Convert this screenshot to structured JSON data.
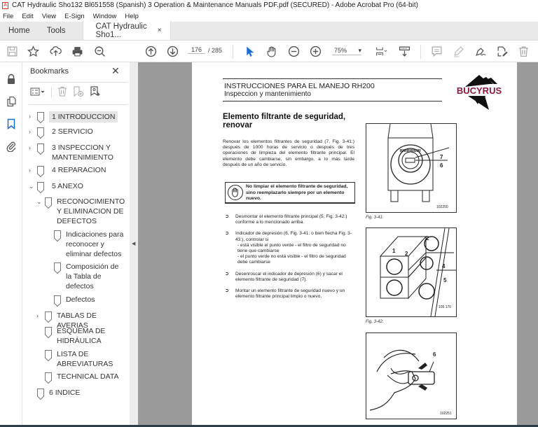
{
  "window": {
    "title": "CAT Hydraulic Sho132 Bl651558 (Spanish) 3 Operation & Maintenance Manuals PDF.pdf (SECURED) - Adobe Acrobat Pro (64-bit)"
  },
  "menu": [
    "File",
    "Edit",
    "View",
    "E-Sign",
    "Window",
    "Help"
  ],
  "tabs": {
    "home": "Home",
    "tools": "Tools",
    "document": "CAT Hydraulic Sho1...",
    "close": "×"
  },
  "toolbar": {
    "current_page": "176",
    "total_pages": "/ 285",
    "zoom": "75%",
    "zoom_arrow": "▾"
  },
  "panel": {
    "title": "Bookmarks",
    "close": "✕",
    "bookmarks": [
      {
        "label": "1 INTRODUCCION",
        "chevron": "›",
        "selected": true
      },
      {
        "label": "2 SERVICIO",
        "chevron": "›"
      },
      {
        "label": "3 INSPECCION Y MANTENIMIENTO",
        "chevron": "›"
      },
      {
        "label": "4 REPARACION",
        "chevron": "›"
      },
      {
        "label": "5 ANEXO",
        "chevron": "⌄"
      },
      {
        "label": "RECONOCIMIENTO Y ELIMINACION DE DEFECTOS",
        "chevron": "⌄"
      },
      {
        "label": "Indicaciones para reconocer y eliminar defectos"
      },
      {
        "label": "Composición de la Tabla de defectos"
      },
      {
        "label": "Defectos"
      },
      {
        "label": "TABLAS DE AVERIAS",
        "chevron": "›"
      },
      {
        "label": "ESQUEMA DE HIDRÁULICA"
      },
      {
        "label": "LISTA DE ABREVIATURAS"
      },
      {
        "label": "TECHNICAL DATA"
      },
      {
        "label": "6 INDICE"
      }
    ]
  },
  "document": {
    "header_line1": "INSTRUCCIONES PARA EL MANEJO RH200",
    "header_line2": "Inspeccion y mantenimiento",
    "logo": "BUCYRUS",
    "logo_color": "#8b1a3a",
    "section_title_1": "Elemento filtrante de seguridad,",
    "section_title_2": "renovar",
    "intro": "Renovar los elementos filtrantes de seguridad (7, Fig. 3-41:) después de 1000 horas de servicio o después de tres operaciones de limpieza del elemento filtrante principal. El elemento debe cambiarse, sin embargo, a lo más tarde después de un año de servicio.",
    "warning": "No limpiar el elemento filtrante de seguridad, sino reemplazarlo siempre por un elemento nuevo.",
    "bullet": "➲",
    "steps": [
      "Desmontar el elemento filtrante principal (5, Fig. 3-42:) conforme a lo mencionado arriba.",
      "Indicador de depresión (6, Fig. 3-41: o bien flecha Fig. 3-43:), controlar si",
      "Desenroscar el indicador de depresión (6) y sacar el elemento filtrante de seguridad (7).",
      "Montar un elemento filtrante de seguridad nuevo y un elemento filtrante principal limpio o nuevo."
    ],
    "substeps": [
      "- está visible el punto verde - el filtro de seguridad no tiene que cambiarse",
      "- el punto verde no está visible - el filtro de seguridad debe cambiarse"
    ],
    "figures": [
      {
        "caption": "Fig. 3-41:",
        "number": "102250",
        "labels": [
          "7",
          "6"
        ]
      },
      {
        "caption": "Fig. 3-42:",
        "number": "105 170",
        "labels": [
          "1",
          "2",
          "2",
          "4",
          "5"
        ]
      },
      {
        "caption": "",
        "number": "102251",
        "labels": [
          "6"
        ]
      }
    ]
  }
}
